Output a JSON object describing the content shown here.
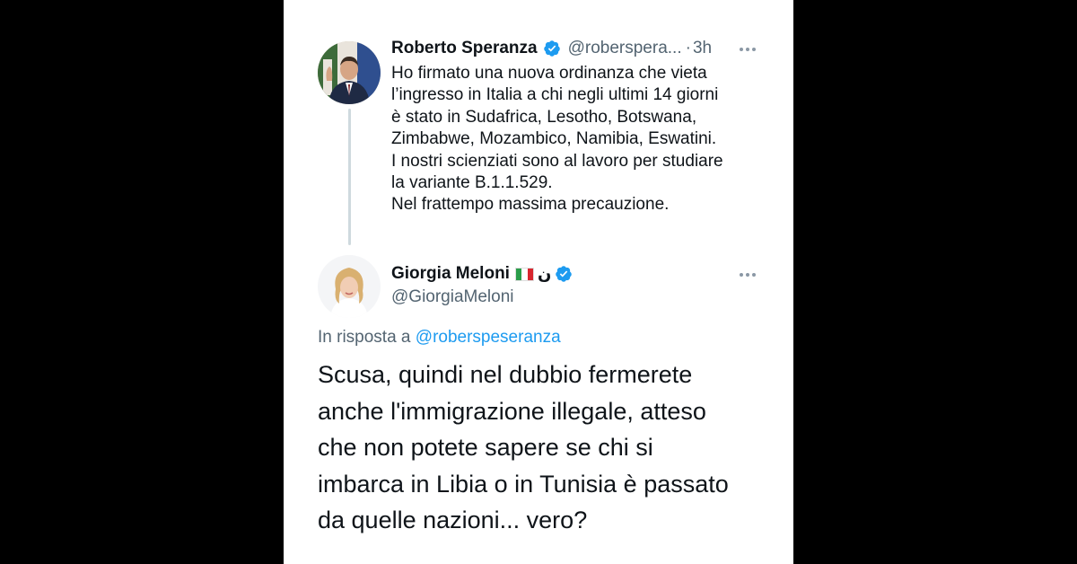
{
  "colors": {
    "background": "#000000",
    "card": "#ffffff",
    "text": "#0f1419",
    "secondary_text": "#536471",
    "link": "#1d9bf0",
    "verified": "#1d9bf0",
    "thread_line": "#cfd9de"
  },
  "tweet1": {
    "author_name": "Roberto Speranza",
    "handle": "@roberspera...",
    "separator": "·",
    "time": "3h",
    "verified_icon": "verified-badge-icon",
    "more_icon": "more-options-icon",
    "lines": [
      "Ho firmato una nuova ordinanza che vieta",
      "l’ingresso in Italia a chi negli ultimi 14 giorni",
      "è stato in Sudafrica, Lesotho, Botswana,",
      "Zimbabwe, Mozambico, Namibia, Eswatini.",
      "I nostri scienziati sono al lavoro per studiare",
      "la variante B.1.1.529.",
      "Nel frattempo massima precauzione."
    ]
  },
  "tweet2": {
    "author_name": "Giorgia Meloni",
    "name_symbol": "ن",
    "flag_icon": "italy-flag-icon",
    "handle": "@GiorgiaMeloni",
    "verified_icon": "verified-badge-icon",
    "more_icon": "more-options-icon",
    "reply_prefix": "In risposta a",
    "reply_mention": "@roberspeseranza",
    "lines": [
      "Scusa, quindi nel dubbio fermerete",
      "anche l'immigrazione illegale, atteso",
      "che non potete sapere se chi si",
      "imbarca in Libia o in Tunisia è passato",
      "da quelle nazioni... vero?"
    ]
  }
}
